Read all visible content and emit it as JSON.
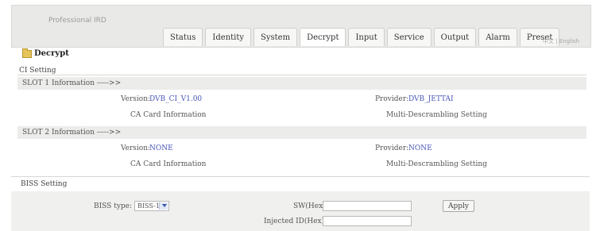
{
  "header": {
    "brand": "Professional IRD",
    "language": "中文 | English",
    "tabs": [
      "Status",
      "Identity",
      "System",
      "Decrypt",
      "Input",
      "Service",
      "Output",
      "Alarm",
      "Preset"
    ],
    "active_tab": "Decrypt"
  },
  "page": {
    "title": "Decrypt",
    "ci_setting_label": "CI Setting"
  },
  "slot1": {
    "header": "SLOT 1 Information ----->>",
    "version_label": "Version:",
    "version_value": "DVB_CI_V1.00",
    "provider_label": "Provider:",
    "provider_value": "DVB_JETTAI",
    "ca_card_label": "CA Card Information",
    "multi_desc_label": "Multi-Descrambling Setting"
  },
  "slot2": {
    "header": "SLOT 2 Information ----->>",
    "version_label": "Version:",
    "version_value": "NONE",
    "provider_label": "Provider:",
    "provider_value": "NONE",
    "ca_card_label": "CA Card Information",
    "multi_desc_label": "Multi-Descrambling Setting"
  },
  "biss": {
    "section_label": "BISS Setting",
    "type_label": "BISS type:",
    "type_value": "BISS-1",
    "sw_label": "SW(Hex):",
    "sw_value": "",
    "injected_label": "Injected ID(Hex):",
    "injected_value": "",
    "apply_label": "Apply"
  },
  "colors": {
    "header_bg": "#e9e9e7",
    "link_value": "#4a57b8",
    "row_gray": "#ececea"
  }
}
